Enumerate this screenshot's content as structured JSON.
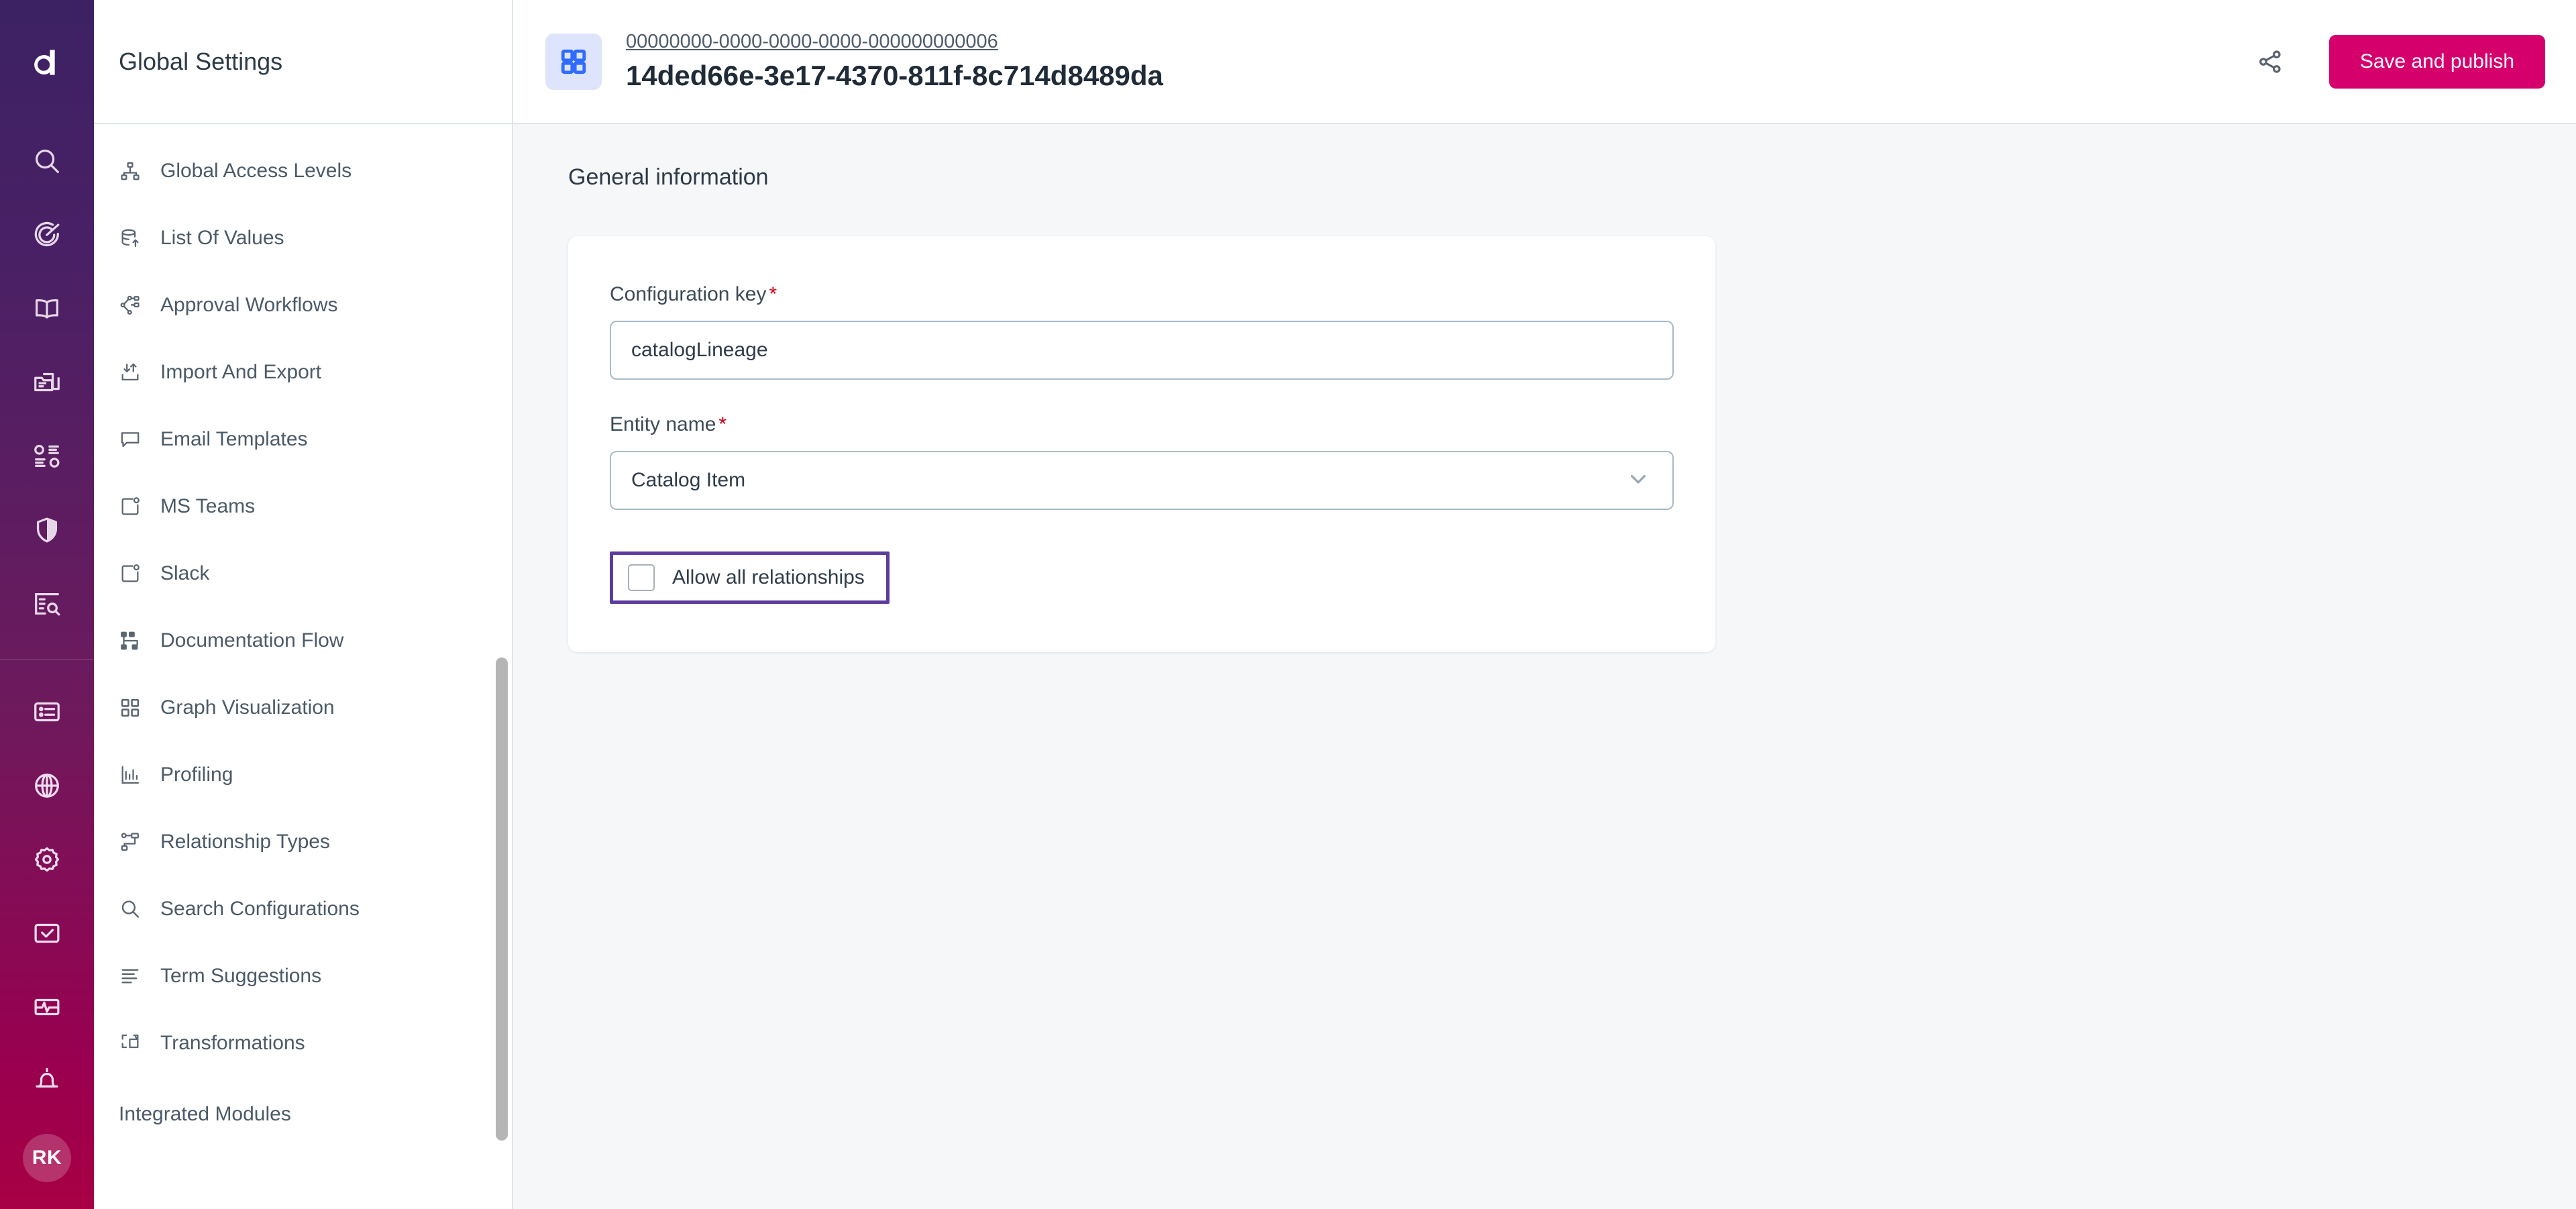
{
  "colors": {
    "brand_magenta": "#d6006d",
    "rail_top": "#3c2263",
    "rail_bottom": "#a80044",
    "accent_blue": "#2f6bff",
    "focus_purple": "#5d3b9e",
    "required_red": "#d0021b",
    "content_bg": "#f5f7f9"
  },
  "rail": {
    "logo": "ataccama-logo-a",
    "top_icons": [
      {
        "name": "search-icon"
      },
      {
        "name": "target-icon"
      },
      {
        "name": "book-icon"
      },
      {
        "name": "catalog-folders-icon"
      },
      {
        "name": "data-sources-icon"
      },
      {
        "name": "shield-icon"
      },
      {
        "name": "rules-search-icon"
      }
    ],
    "bottom_icons": [
      {
        "name": "list-view-icon"
      },
      {
        "name": "globe-icon"
      },
      {
        "name": "gear-icon"
      },
      {
        "name": "tasks-check-icon"
      },
      {
        "name": "monitoring-icon"
      },
      {
        "name": "bell-icon"
      }
    ],
    "avatar_initials": "RK"
  },
  "sidebar": {
    "title": "Global Settings",
    "items": [
      {
        "label": "Global Access Levels",
        "icon": "org-tree-icon"
      },
      {
        "label": "List Of Values",
        "icon": "database-up-icon"
      },
      {
        "label": "Approval Workflows",
        "icon": "workflow-icon"
      },
      {
        "label": "Import And Export",
        "icon": "import-export-icon"
      },
      {
        "label": "Email Templates",
        "icon": "comment-icon"
      },
      {
        "label": "MS Teams",
        "icon": "app-dot-icon"
      },
      {
        "label": "Slack",
        "icon": "app-dot-icon"
      },
      {
        "label": "Documentation Flow",
        "icon": "doc-flow-icon"
      },
      {
        "label": "Graph Visualization",
        "icon": "grid-squares-icon"
      },
      {
        "label": "Profiling",
        "icon": "bar-chart-icon"
      },
      {
        "label": "Relationship Types",
        "icon": "relationship-icon"
      },
      {
        "label": "Search Configurations",
        "icon": "search-icon"
      },
      {
        "label": "Term Suggestions",
        "icon": "text-lines-icon"
      },
      {
        "label": "Transformations",
        "icon": "transform-icon"
      }
    ],
    "group_title": "Integrated Modules"
  },
  "topbar": {
    "app_icon": "grid-squares-icon",
    "breadcrumb": "00000000-0000-0000-0000-000000000006",
    "title": "14ded66e-3e17-4370-811f-8c714d8489da",
    "share_icon": "share-icon",
    "publish_label": "Save and publish"
  },
  "main": {
    "section_title": "General information",
    "fields": {
      "configuration_key": {
        "label": "Configuration key",
        "required_marker": "*",
        "value": "catalogLineage",
        "placeholder": "Configuration key"
      },
      "entity_name": {
        "label": "Entity name",
        "required_marker": "*",
        "value": "Catalog Item",
        "chevron_icon": "chevron-down-icon"
      },
      "allow_all_relationships": {
        "label": "Allow all relationships",
        "checked": false
      }
    }
  }
}
